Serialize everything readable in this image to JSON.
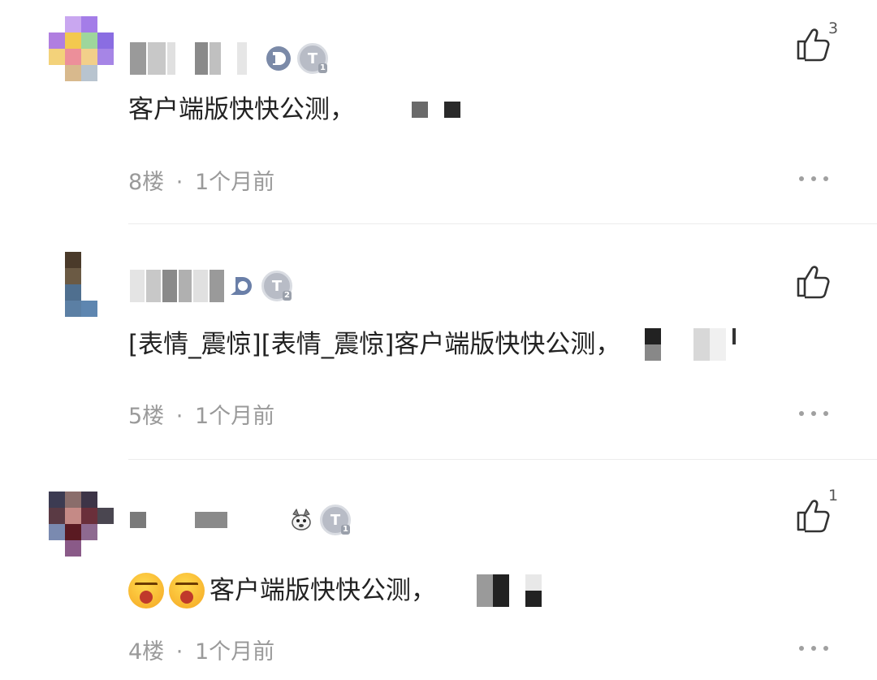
{
  "comments": [
    {
      "text": "客户端版快快公测，",
      "floor": "8楼",
      "separator": "·",
      "time": "1个月前",
      "likes": "3",
      "user_level": "1",
      "badge_letter": "T",
      "avatar_colors": [
        "#ffffff",
        "#c9a7f0",
        "#a47de8",
        "#ffffff",
        "#b07ee0",
        "#f3c94f",
        "#9ed69c",
        "#8a6de2",
        "#f3d27a",
        "#ec8f9a",
        "#f2cf8a",
        "#a685e6",
        "#ffffff",
        "#d8b98d",
        "#b8c4cf",
        "#ffffff"
      ]
    },
    {
      "text": "[表情_震惊][表情_震惊]客户端版快快公测，",
      "floor": "5楼",
      "separator": "·",
      "time": "1个月前",
      "likes": "",
      "user_level": "2",
      "badge_letter": "T",
      "avatar_colors": [
        "#ffffff",
        "#4a3a2a",
        "#ffffff",
        "#ffffff",
        "#ffffff",
        "#6b5a44",
        "#ffffff",
        "#ffffff",
        "#ffffff",
        "#4f6f8f",
        "#ffffff",
        "#ffffff",
        "#ffffff",
        "#5b7fa4",
        "#5e86b0",
        "#ffffff"
      ]
    },
    {
      "text": "客户端版快快公测，",
      "floor": "4楼",
      "separator": "·",
      "time": "1个月前",
      "likes": "1",
      "user_level": "1",
      "badge_letter": "T",
      "avatar_colors": [
        "#3c3b52",
        "#8a6d6b",
        "#3d3447",
        "#ffffff",
        "#5a3a44",
        "#c58a86",
        "#6a2f3a",
        "#4a4650",
        "#7a8ab0",
        "#5a1a22",
        "#8e6a90",
        "#ffffff",
        "#ffffff",
        "#8a5a88",
        "#ffffff",
        "#ffffff"
      ]
    }
  ]
}
